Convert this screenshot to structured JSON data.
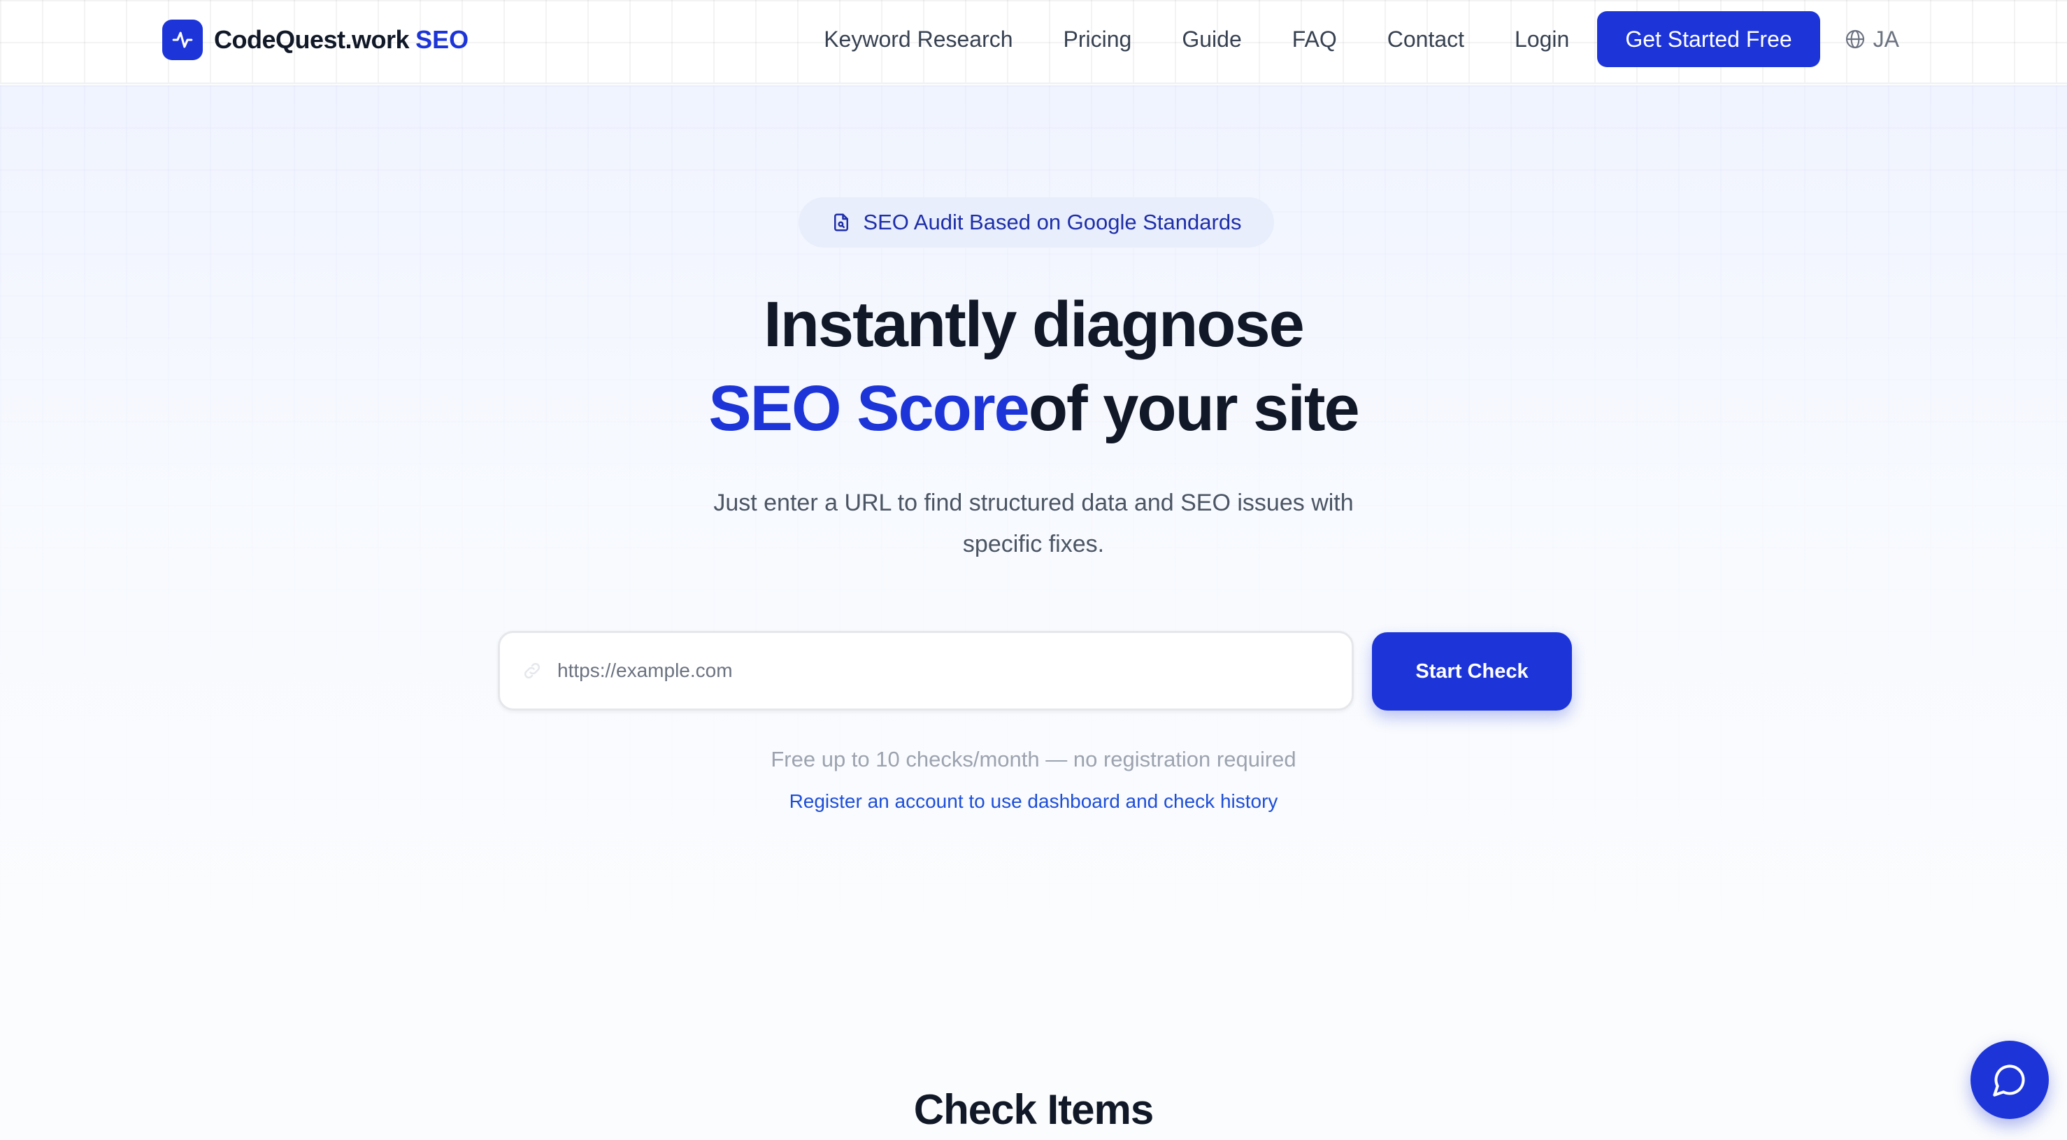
{
  "brand": {
    "name": "CodeQuest.work",
    "accent": "SEO",
    "logo_icon": "activity-pulse-icon",
    "color": "#1d35d8"
  },
  "nav": {
    "links": [
      "Keyword Research",
      "Pricing",
      "Guide",
      "FAQ",
      "Contact",
      "Login"
    ],
    "cta_label": "Get Started Free",
    "language": {
      "icon": "globe-icon",
      "label": "JA"
    }
  },
  "hero": {
    "badge": {
      "icon": "document-search-icon",
      "label": "SEO Audit Based on Google Standards"
    },
    "headline_line1": "Instantly diagnose",
    "headline_accent": "SEO Score",
    "headline_rest": "of your site",
    "subtitle": "Just enter a URL to find structured data and SEO issues with specific fixes.",
    "url_input": {
      "placeholder": "https://example.com",
      "value": "",
      "icon": "link-icon"
    },
    "start_button": "Start Check",
    "free_note": "Free up to 10 checks/month — no registration required",
    "register_link": "Register an account to use dashboard and check history"
  },
  "sections": {
    "check_items_title": "Check Items"
  },
  "chat": {
    "icon": "chat-bubble-icon"
  }
}
